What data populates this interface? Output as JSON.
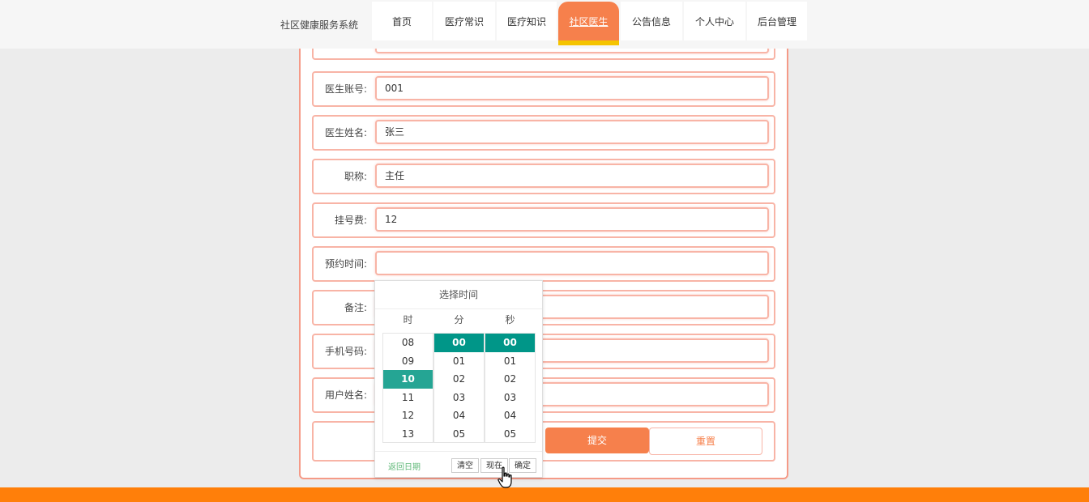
{
  "header": {
    "site_title": "社区健康服务系统",
    "nav": [
      {
        "label": "首页"
      },
      {
        "label": "医疗常识"
      },
      {
        "label": "医疗知识"
      },
      {
        "label": "社区医生",
        "active": true
      },
      {
        "label": "公告信息"
      },
      {
        "label": "个人中心"
      },
      {
        "label": "后台管理"
      }
    ]
  },
  "form": {
    "rows": [
      {
        "label": "",
        "value": ""
      },
      {
        "label": "医生账号:",
        "value": "001"
      },
      {
        "label": "医生姓名:",
        "value": "张三"
      },
      {
        "label": "职称:",
        "value": "主任"
      },
      {
        "label": "挂号费:",
        "value": "12"
      },
      {
        "label": "预约时间:",
        "value": ""
      },
      {
        "label": "备注:",
        "value": ""
      },
      {
        "label": "手机号码:",
        "value": ""
      },
      {
        "label": "用户姓名:",
        "value": ""
      }
    ],
    "submit_label": "提交",
    "reset_label": "重置"
  },
  "time_picker": {
    "title": "选择时间",
    "headers": {
      "hour": "时",
      "minute": "分",
      "second": "秒"
    },
    "hours": [
      "08",
      "09",
      "10",
      "11",
      "12",
      "13"
    ],
    "minutes": [
      "00",
      "01",
      "02",
      "03",
      "04",
      "05"
    ],
    "seconds": [
      "00",
      "01",
      "02",
      "03",
      "04",
      "05"
    ],
    "selected": {
      "hour": "10",
      "minute": "00",
      "second": "00"
    },
    "back_label": "返回日期",
    "clear_label": "清空",
    "now_label": "现在",
    "confirm_label": "确定"
  },
  "colors": {
    "accent": "#f6804c",
    "nav_underline": "#f5c400",
    "picker_selected": "#009688",
    "footer_bar": "#ff7f0a"
  }
}
